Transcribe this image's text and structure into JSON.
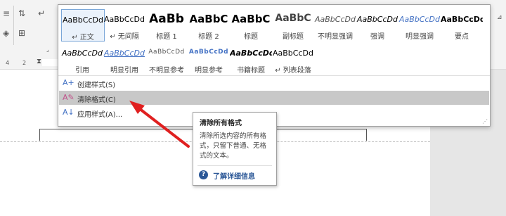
{
  "ruler": {
    "numbers": [
      "4",
      "2"
    ]
  },
  "styles_row1": [
    {
      "preview": "AaBbCcDd",
      "name": "↵ 正文",
      "selected": true
    },
    {
      "preview": "AaBbCcDd",
      "name": "↵ 无间隔"
    },
    {
      "preview": "AaBb",
      "name": "标题 1"
    },
    {
      "preview": "AaBbC",
      "name": "标题 2"
    },
    {
      "preview": "AaBbC",
      "name": "标题"
    },
    {
      "preview": "AaBbC",
      "name": "副标题"
    },
    {
      "preview": "AaBbCcDd",
      "name": "不明显强调"
    },
    {
      "preview": "AaBbCcDd",
      "name": "强调"
    },
    {
      "preview": "AaBbCcDd",
      "name": "明显强调"
    },
    {
      "preview": "AaBbCcDd",
      "name": "要点"
    }
  ],
  "styles_row2": [
    {
      "preview": "AaBbCcDd",
      "name": "引用"
    },
    {
      "preview": "AaBbCcDd",
      "name": "明显引用"
    },
    {
      "preview": "AaBbCcDd",
      "name": "不明显参考"
    },
    {
      "preview": "AaBbCcDd",
      "name": "明显参考"
    },
    {
      "preview": "AaBbCcDd",
      "name": "书籍标题"
    },
    {
      "preview": "AaBbCcDd",
      "name": "↵ 列表段落"
    }
  ],
  "menu": {
    "create_style": "创建样式(S)",
    "clear_format": "清除格式(C)",
    "apply_style": "应用样式(A)..."
  },
  "tooltip": {
    "title": "清除所有格式",
    "body": "清除所选内容的所有格式，只留下普通、无格式的文本。",
    "help": "了解详细信息"
  },
  "colors": {
    "arrow": "#e02020",
    "link": "#2b5797",
    "highlight": "#c8c8c8"
  }
}
